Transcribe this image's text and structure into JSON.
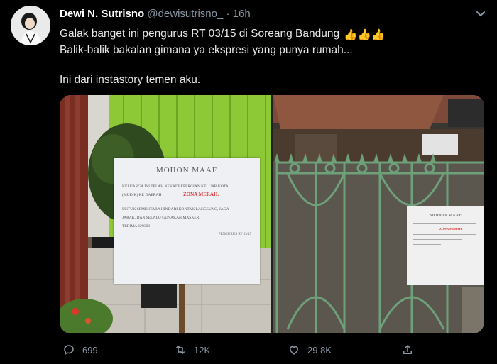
{
  "tweet": {
    "author_name": "Dewi N. Sutrisno",
    "handle": "@dewisutrisno_",
    "separator": "·",
    "time": "16h",
    "text_line1": "Galak banget ini pengurus RT 03/15 di Soreang Bandung",
    "text_emoji": "👍👍👍",
    "text_line2": "Balik-balik bakalan gimana ya ekspresi yang punya rumah...",
    "text_line4": "Ini dari instastory temen aku."
  },
  "media": {
    "left_notice": {
      "title": "MOHON MAAF",
      "line1": "KELUARGA INI TELAH NEKAT   BEPERGIAN KELUAR KOTA",
      "line2": "(MUDIK) KE DAERAH",
      "zona": "ZONA MERAH.",
      "line3": "UNTUK SEMENTARA HINDARI  KONTAK LANGSUNG, JAGA",
      "line4": "JARAK, DAN SELALU  GUNAKAN MASKER.",
      "line5": "TERIMA  KASIH",
      "sign": "PENGURUS RT 03/15"
    },
    "right_notice": {
      "title": "MOHON MAAF",
      "zona": "ZONA MERAH"
    }
  },
  "actions": {
    "replies": "699",
    "retweets": "12K",
    "likes": "29.8K"
  }
}
